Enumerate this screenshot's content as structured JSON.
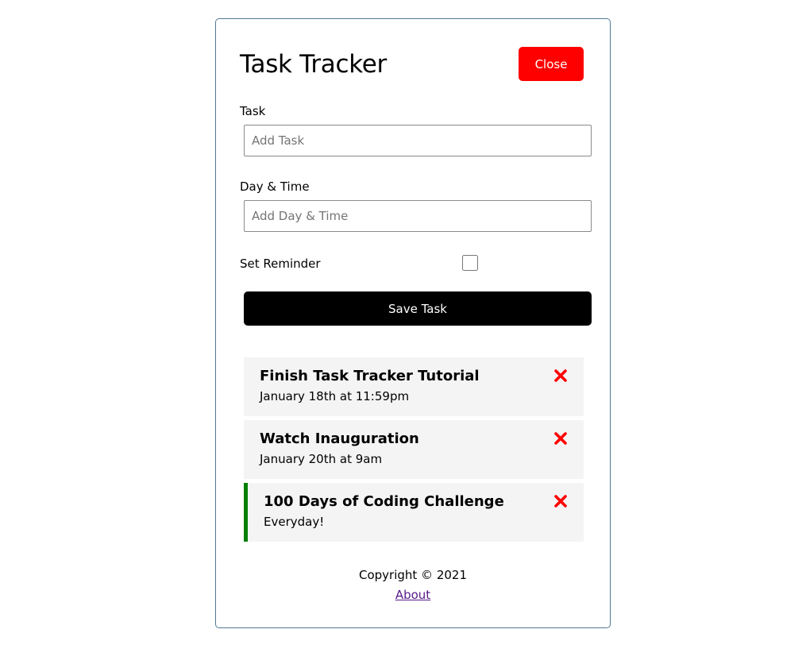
{
  "header": {
    "title": "Task Tracker",
    "close_label": "Close",
    "close_color": "#ff0000"
  },
  "form": {
    "task_label": "Task",
    "task_placeholder": "Add Task",
    "task_value": "",
    "day_label": "Day & Time",
    "day_placeholder": "Add Day & Time",
    "day_value": "",
    "reminder_label": "Set Reminder",
    "reminder_checked": false,
    "save_label": "Save Task"
  },
  "tasks": [
    {
      "text": "Finish Task Tracker Tutorial",
      "day": "January 18th at 11:59pm",
      "reminder": false
    },
    {
      "text": "Watch Inauguration",
      "day": "January 20th at 9am",
      "reminder": false
    },
    {
      "text": "100 Days of Coding Challenge",
      "day": "Everyday!",
      "reminder": true
    }
  ],
  "icons": {
    "delete": "times-icon",
    "delete_color": "#ff0000",
    "reminder_border_color": "#008000"
  },
  "footer": {
    "copyright": "Copyright © 2021",
    "about_label": "About"
  }
}
